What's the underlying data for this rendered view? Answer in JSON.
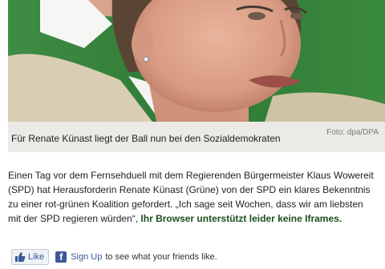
{
  "photo": {
    "alt_subject": "Renate Künast",
    "background_color": "#2f7a3a"
  },
  "caption": {
    "text": "Für Renate Künast liegt der Ball nun bei den Sozialdemokraten",
    "credit": "Foto: dpa/DPA"
  },
  "article": {
    "line1": "Einen Tag vor dem Fernsehduell mit dem Regierenden Bürgermeister Klaus Wowereit",
    "line2": "(SPD) hat Herausforderin Renate Künast (Grüne) von der SPD ein klares Bekenntnis",
    "line3": "zu einer rot-grünen Koalition gefordert. „Ich sage seit Wochen, dass wir am liebsten",
    "line4_prefix": "mit der SPD regieren würden“, ",
    "iframe_note": "Ihr Browser unterstützt leider keine Iframes."
  },
  "social": {
    "like_label": "Like",
    "like_icon": "thumbs-up-icon",
    "facebook_icon": "facebook-icon",
    "signup_label": "Sign Up",
    "signup_suffix": "to see what your friends like."
  }
}
